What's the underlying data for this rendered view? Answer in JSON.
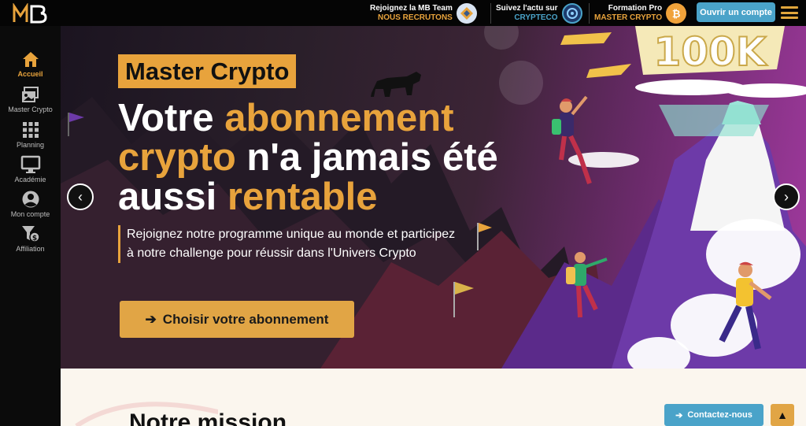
{
  "brand": {
    "logo_text": "MB"
  },
  "topbar": {
    "promos": [
      {
        "line1": "Rejoignez la MB Team",
        "line2": "NOUS RECRUTONS",
        "icon": "team-icon",
        "line2_color": "#e8a33c"
      },
      {
        "line1": "Suivez l'actu sur",
        "line2": "CRYPTECO",
        "icon": "crypteco-icon",
        "line2_color": "#4aa3c9"
      },
      {
        "line1": "Formation Pro",
        "line2": "MASTER CRYPTO",
        "icon": "bitcoin-icon",
        "line2_color": "#e8a33c"
      }
    ],
    "open_account": "Ouvrir un compte"
  },
  "sidebar": {
    "items": [
      {
        "label": "Accueil",
        "icon": "home-icon",
        "active": true
      },
      {
        "label": "Master Crypto",
        "icon": "master-crypto-icon",
        "active": false
      },
      {
        "label": "Planning",
        "icon": "grid-icon",
        "active": false
      },
      {
        "label": "Académie",
        "icon": "monitor-icon",
        "active": false
      },
      {
        "label": "Mon compte",
        "icon": "user-icon",
        "active": false
      },
      {
        "label": "Affiliation",
        "icon": "affiliation-icon",
        "active": false
      }
    ]
  },
  "hero": {
    "tagline": "Master Crypto",
    "headline_1": "Votre ",
    "headline_hl_1": "abonnement",
    "headline_hl_2": "crypto",
    "headline_2": " n'a jamais été",
    "headline_3": "aussi ",
    "headline_hl_3": "rentable",
    "lead": "Rejoignez notre programme unique au monde et participez à notre challenge pour réussir dans l'Univers Crypto",
    "cta": "Choisir votre abonnement",
    "banner_text": "100K"
  },
  "mission": {
    "title": "Notre mission",
    "contact": "Contactez-nous"
  },
  "colors": {
    "accent": "#e8a33c",
    "info": "#4aa3c9",
    "dark": "#0b0b0b"
  }
}
